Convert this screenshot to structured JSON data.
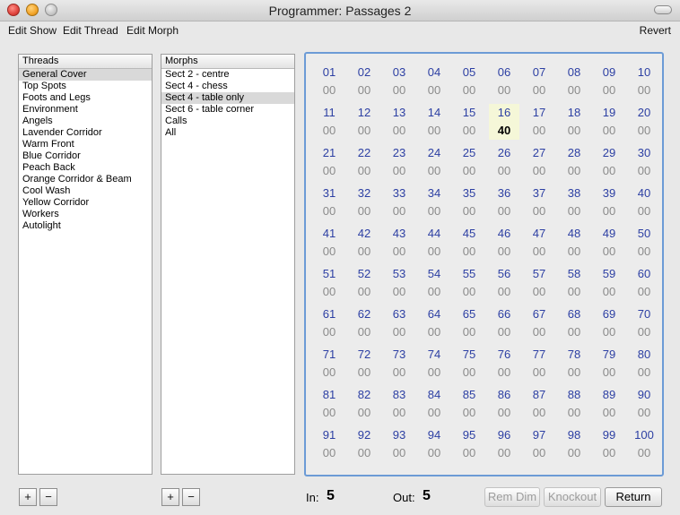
{
  "window": {
    "title": "Programmer: Passages 2"
  },
  "menu": {
    "edit_show": "Edit Show",
    "edit_thread": "Edit Thread",
    "edit_morph": "Edit Morph",
    "revert": "Revert"
  },
  "threads": {
    "header": "Threads",
    "selected_index": 0,
    "items": [
      "General Cover",
      "Top Spots",
      "Foots and Legs",
      "Environment",
      "Angels",
      "Lavender Corridor",
      "Warm Front",
      "Blue Corridor",
      "Peach Back",
      "Orange Corridor & Beam",
      "Cool Wash",
      "Yellow Corridor",
      "Workers",
      "Autolight"
    ],
    "add_label": "+",
    "remove_label": "−"
  },
  "morphs": {
    "header": "Morphs",
    "selected_index": 2,
    "items": [
      "Sect 2 - centre",
      "Sect 4 - chess",
      "Sect 4 - table only",
      "Sect 6 - table corner",
      "Calls",
      "All"
    ],
    "add_label": "+",
    "remove_label": "−"
  },
  "channels": {
    "default_value": "00",
    "highlight_channel": 16,
    "values": {
      "16": "40"
    }
  },
  "status": {
    "in_label": "In:",
    "in_value": "5",
    "out_label": "Out:",
    "out_value": "5"
  },
  "buttons": {
    "rem_dim": "Rem Dim",
    "knockout": "Knockout",
    "return": "Return"
  }
}
